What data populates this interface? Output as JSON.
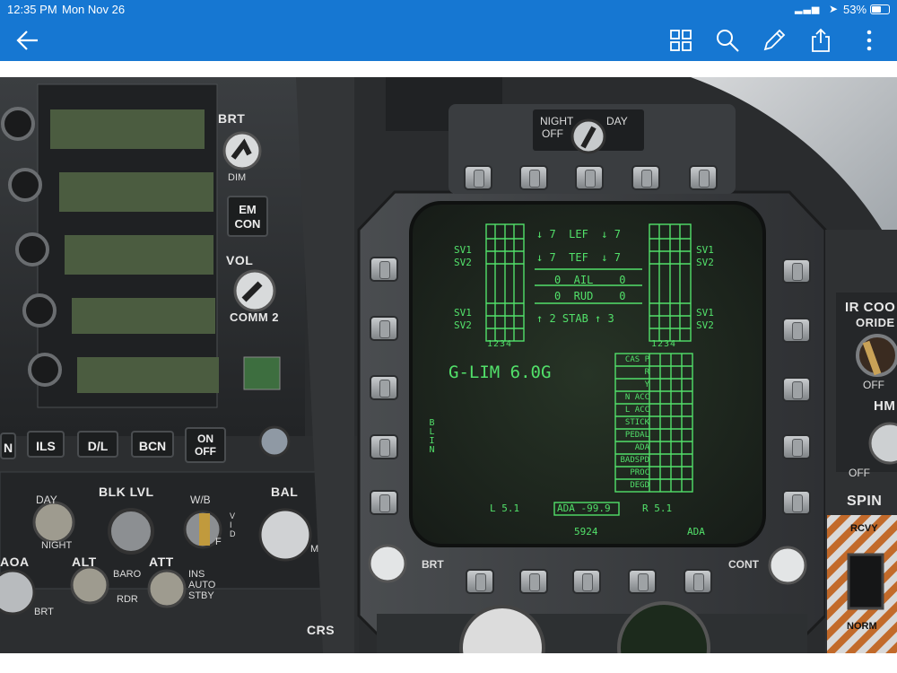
{
  "status_bar": {
    "time": "12:35 PM",
    "date": "Mon Nov 26",
    "battery": "53%"
  },
  "toolbar": {
    "icons": [
      "back-arrow-icon",
      "grid-icon",
      "search-icon",
      "pencil-icon",
      "share-icon",
      "more-icon"
    ]
  },
  "cockpit": {
    "left_panel": {
      "brt": "BRT",
      "dim": "DIM",
      "em_con_line1": "EM",
      "em_con_line2": "CON",
      "vol": "VOL",
      "comm2": "COMM 2",
      "buttons": [
        "N",
        "ILS",
        "D/L",
        "BCN"
      ],
      "on_line1": "ON",
      "on_line2": "OFF",
      "day": "DAY",
      "night": "NIGHT",
      "blk_lvl": "BLK LVL",
      "wb": "W/B",
      "vid": "V\nI\nD",
      "f": "F",
      "bal": "BAL",
      "m": "M",
      "aoa": "AOA",
      "alt": "ALT",
      "baro": "BARO",
      "rdr": "RDR",
      "att": "ATT",
      "ins": "INS",
      "auto": "AUTO",
      "stby": "STBY",
      "brt2": "BRT",
      "crs": "CRS"
    },
    "mfd": {
      "night_label": "NIGHT",
      "day_label": "DAY",
      "off_label": "OFF",
      "brt": "BRT",
      "cont": "CONT",
      "sv1": "SV1",
      "sv2": "SV2",
      "col_nums": "1234",
      "lef": "↓ 7  LEF  ↓ 7",
      "tef": "↓ 7  TEF  ↓ 7",
      "ail": "0  AIL    0",
      "rud": "0  RUD    0",
      "stab": "↑ 2 STAB ↑ 3",
      "glim": "G-LIM 6.0G",
      "blin": "BLIN",
      "fcs_labels": [
        "CAS P",
        "R",
        "Y",
        "N ACC",
        "L ACC",
        "STICK",
        "PEDAL",
        "ADA",
        "BADSPD",
        "PROC",
        "DEGD"
      ],
      "l_val": "L 5.1",
      "aoa_box": "ADA -99.9",
      "r_val": "R 5.1",
      "code": "5924",
      "ada": "ADA"
    },
    "right_panel": {
      "ir_cool": "IR COO",
      "oride": "ORIDE",
      "off": "OFF",
      "hm": "HM",
      "off2": "OFF",
      "spin": "SPIN",
      "rcvy": "RCVY",
      "norm": "NORM"
    }
  }
}
